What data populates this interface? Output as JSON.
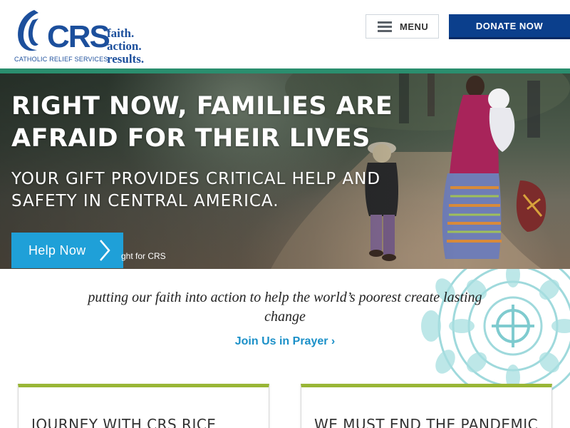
{
  "header": {
    "logo": {
      "wordmark": "CRS",
      "org_name": "CATHOLIC RELIEF SERVICES",
      "tagline": [
        "faith.",
        "action.",
        "results."
      ]
    },
    "menu_label": "MENU",
    "donate_label": "DONATE NOW"
  },
  "hero": {
    "title": "RIGHT NOW, FAMILIES ARE AFRAID FOR THEIR LIVES",
    "subtitle": "YOUR GIFT PROVIDES CRITICAL HELP AND SAFETY IN CENTRAL AMERICA.",
    "cta_label": "Help Now",
    "photo_credit": "ght for CRS"
  },
  "mission": {
    "statement": "putting our faith into action to help the world’s poorest create lasting change",
    "prayer_link": "Join Us in Prayer ›"
  },
  "cards": [
    {
      "title": "JOURNEY WITH CRS RICE"
    },
    {
      "title": "WE MUST END THE PANDEMIC"
    }
  ],
  "colors": {
    "brand_blue": "#1c4f9c",
    "donate_bg": "#0b3f8c",
    "divider_green": "#2a8e6e",
    "cta_blue": "#1fa0d8",
    "link_blue": "#1b90c8",
    "card_accent": "#99b636",
    "mandala": "#8fd3d6"
  },
  "icons": {
    "menu": "hamburger-icon",
    "cta": "chevron-right-icon",
    "decoration": "mandala-cross-ornament"
  }
}
